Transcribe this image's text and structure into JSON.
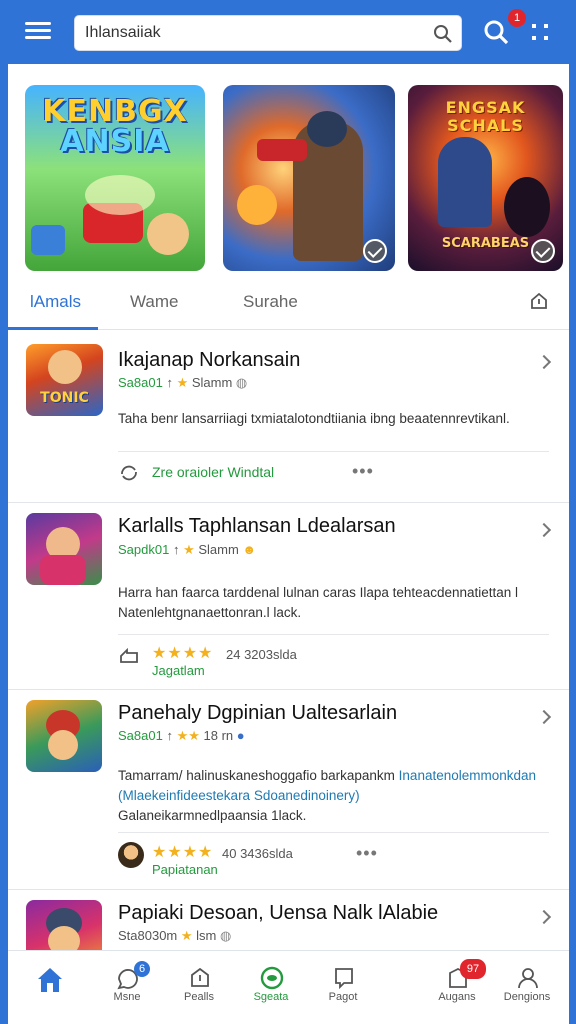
{
  "header": {
    "search_value": "Ihlansaiiak",
    "notification_count": "1"
  },
  "banners": [
    {
      "title": "KENBGX",
      "title2": "ANSIA"
    },
    {
      "title": ""
    },
    {
      "title": "ENGSAK",
      "title2": "SCHALS",
      "subtitle": "SCARABEAS"
    }
  ],
  "tabs": [
    {
      "label": "lAmals",
      "active": true
    },
    {
      "label": "Wame",
      "active": false
    },
    {
      "label": "Surahe",
      "active": false
    }
  ],
  "cards": [
    {
      "title": "Ikajanap Norkansain",
      "meta_green": "Sa8a01",
      "meta_rest": "Slamm",
      "thumb_label": "TONIC",
      "description": "Taha benr lansarriiagi txmiatalotondtiiania ibng beaatennrevtikanl.",
      "footer_text": "Zre oraioler Windtal"
    },
    {
      "title": "Karlalls Taphlansan Ldealarsan",
      "meta_green": "Sapdk01",
      "meta_rest": "Slamm",
      "description": "Harra han faarca tarddenal lulnan caras Ilapa tehteacdennatiettan l Natenlehtgnanaettonran.l lack.",
      "footer_count": "24 3203slda",
      "footer_green": "Jagatlam"
    },
    {
      "title": "Panehaly Dgpinian Ualtesarlain",
      "meta_green": "Sa8a01",
      "meta_rest": "18 rn",
      "description_1": "Tamarram/ halinuskaneshoggafio barkapankm",
      "description_1b": "Inanatenolemmonkdan",
      "description_2": "(Mlaekeinfideestekara Sdoanedinoinery)",
      "description_3": "Galaneikarmnedlpaansia 1lack.",
      "footer_count": "40 3436slda",
      "footer_green": "Papiatanan"
    },
    {
      "title": "Papiaki Desoan, Uensa Nalk lAlabie",
      "meta": "Sta8030m",
      "meta_rest": "lsm"
    }
  ],
  "bottom_nav": [
    {
      "label": "",
      "active": false
    },
    {
      "label": "Msne",
      "badge": "6"
    },
    {
      "label": "Pealls"
    },
    {
      "label": "Sgeata",
      "active": true
    },
    {
      "label": "Pagot"
    },
    {
      "label": "Augans",
      "badge": "97"
    },
    {
      "label": "Dengions"
    }
  ],
  "colors": {
    "brand_blue": "#2f73d6",
    "accent_green": "#239a3d",
    "star_gold": "#f2b11d",
    "badge_red": "#e0262c"
  }
}
